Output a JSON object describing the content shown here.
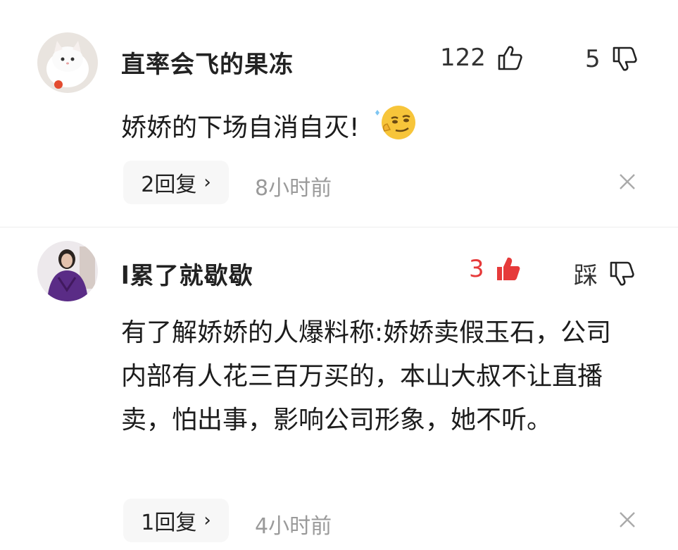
{
  "comments": [
    {
      "username": "直率会飞的果冻",
      "like_count": "122",
      "dislike_label": "5",
      "liked": false,
      "text": "娇娇的下场自消自灭!",
      "emoji_icon": "smirk-emoji",
      "reply_label": "2回复",
      "reply_chevron": "›",
      "time": "8小时前"
    },
    {
      "username": "l累了就歇歇",
      "like_count": "3",
      "dislike_label": "踩",
      "liked": true,
      "text": "有了解娇娇的人爆料称:娇娇卖假玉石，公司内部有人花三百万买的，本山大叔不让直播卖，怕出事，影响公司形象，她不听。",
      "reply_label": "1回复",
      "reply_chevron": "›",
      "time": "4小时前"
    }
  ],
  "colors": {
    "liked": "#e63a3a",
    "muted": "#9a9a9a",
    "reply_bg": "#f7f7f7"
  }
}
